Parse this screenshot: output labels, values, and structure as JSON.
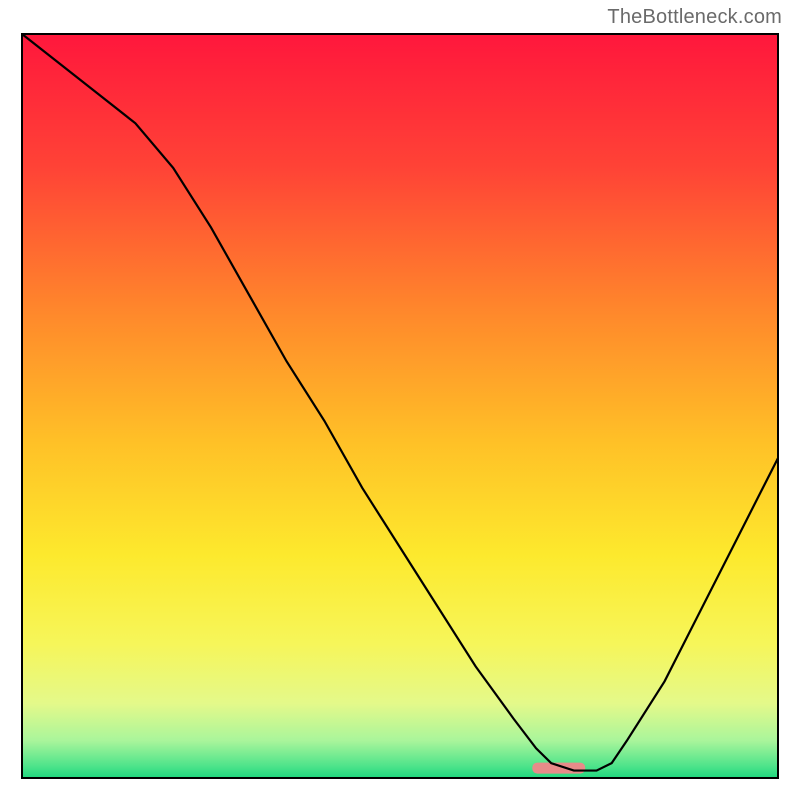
{
  "watermark": "TheBottleneck.com",
  "chart_data": {
    "type": "line",
    "title": "",
    "xlabel": "",
    "ylabel": "",
    "xlim": [
      0,
      100
    ],
    "ylim": [
      0,
      100
    ],
    "x": [
      0,
      5,
      10,
      15,
      20,
      25,
      30,
      35,
      40,
      45,
      50,
      55,
      60,
      65,
      68,
      70,
      73,
      76,
      78,
      80,
      85,
      90,
      95,
      100
    ],
    "values": [
      100,
      96,
      92,
      88,
      82,
      74,
      65,
      56,
      48,
      39,
      31,
      23,
      15,
      8,
      4,
      2,
      1,
      1,
      2,
      5,
      13,
      23,
      33,
      43
    ],
    "background_gradient": {
      "type": "vertical",
      "stops": [
        {
          "pos": 0.0,
          "color": "#ff173c"
        },
        {
          "pos": 0.18,
          "color": "#ff4336"
        },
        {
          "pos": 0.38,
          "color": "#ff8a2b"
        },
        {
          "pos": 0.55,
          "color": "#ffc127"
        },
        {
          "pos": 0.7,
          "color": "#fde92d"
        },
        {
          "pos": 0.82,
          "color": "#f6f65a"
        },
        {
          "pos": 0.9,
          "color": "#e4f98a"
        },
        {
          "pos": 0.95,
          "color": "#a9f59b"
        },
        {
          "pos": 0.985,
          "color": "#4be38a"
        },
        {
          "pos": 1.0,
          "color": "#1fd67e"
        }
      ]
    },
    "marker": {
      "x_center": 71,
      "width": 7,
      "color": "#e88b89",
      "y_fraction": 0.986
    },
    "axes_visible": false,
    "border": {
      "color": "#000000",
      "width": 2
    }
  }
}
